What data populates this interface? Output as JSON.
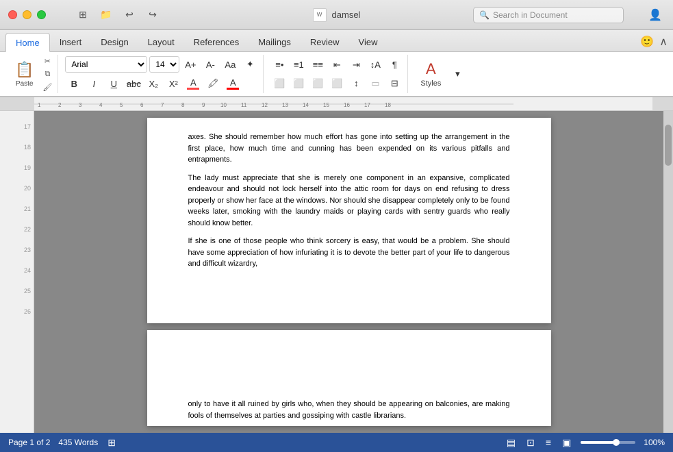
{
  "window": {
    "title": "damsel",
    "traffic_lights": [
      "red",
      "yellow",
      "green"
    ]
  },
  "titlebar": {
    "doc_icon_text": "W",
    "title": "damsel",
    "search_placeholder": "Search in Document",
    "undo_label": "↩",
    "redo_label": "↪"
  },
  "tabs": {
    "items": [
      "Home",
      "Insert",
      "Design",
      "Layout",
      "References",
      "Mailings",
      "Review",
      "View"
    ],
    "active": "Home"
  },
  "ribbon": {
    "paste_label": "Paste",
    "font_name": "Arial",
    "font_size": "14",
    "bold_label": "B",
    "italic_label": "I",
    "underline_label": "U",
    "strikethrough_label": "abc",
    "subscript_label": "X₂",
    "superscript_label": "X²",
    "styles_label": "Styles"
  },
  "document": {
    "page1_paragraphs": [
      "axes. She should remember how much effort has gone into setting up the arrangement in the first place, how much time and cunning has been expended on its various pitfalls and entrapments.",
      "The lady must appreciate that she is merely one component in an expansive, complicated endeavour and should not lock herself into the attic room for days on end refusing to dress properly or show her face at the windows. Nor should she disappear completely only to be found weeks later, smoking with the laundry maids or playing cards with sentry guards who really should know better.",
      "If she is one of those people who think sorcery is easy, that would be a problem. She should have some appreciation of how infuriating it is to devote the better part of your life to dangerous and difficult wizardry,"
    ],
    "page2_paragraphs": [
      "only to have it all ruined by girls who, when they should be appearing on balconies, are making fools of themselves at parties and gossiping with castle librarians."
    ]
  },
  "status_bar": {
    "page_info": "Page 1 of 2",
    "word_count": "435 Words",
    "zoom_percent": "100%"
  },
  "margin_numbers": [
    "17",
    "18",
    "19",
    "20",
    "21",
    "22",
    "23",
    "24",
    "25",
    "26"
  ]
}
